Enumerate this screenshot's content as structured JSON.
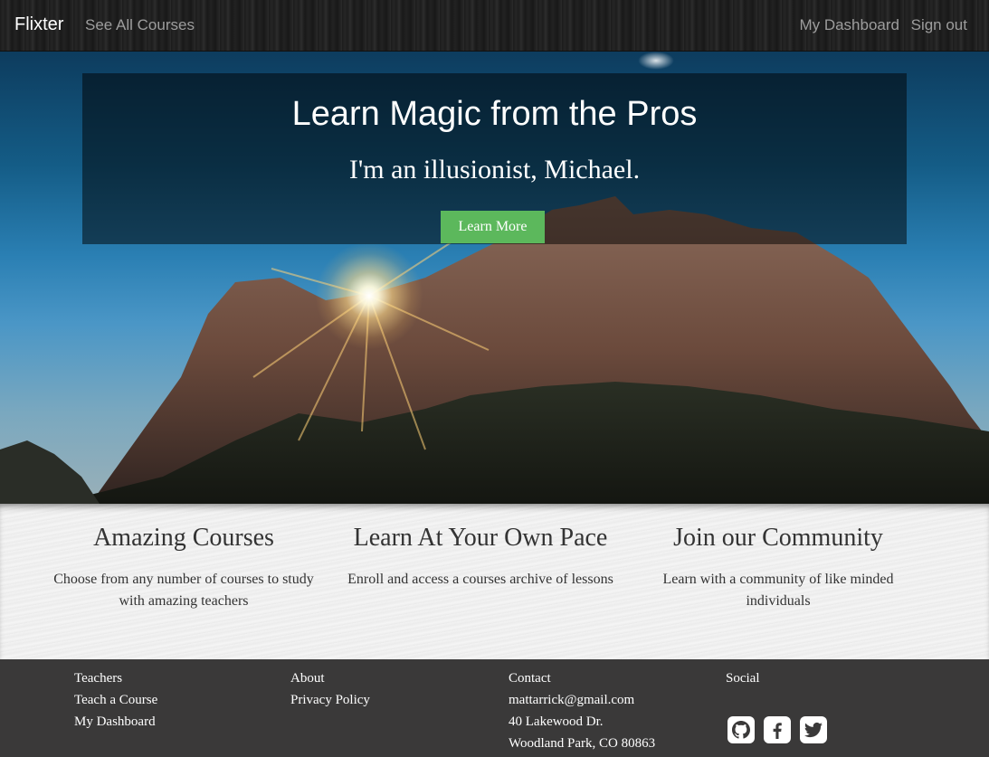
{
  "navbar": {
    "brand": "Flixter",
    "see_all_courses": "See All Courses",
    "my_dashboard": "My Dashboard",
    "sign_out": "Sign out"
  },
  "hero": {
    "title": "Learn Magic from the Pros",
    "subtitle": "I'm an illusionist, Michael.",
    "button_label": "Learn More",
    "button_color": "#5cb85c"
  },
  "features": [
    {
      "title": "Amazing Courses",
      "text": "Choose from any number of courses to study with amazing teachers"
    },
    {
      "title": "Learn At Your Own Pace",
      "text": "Enroll and access a courses archive of lessons"
    },
    {
      "title": "Join our Community",
      "text": "Learn with a community of like minded individuals"
    }
  ],
  "footer": {
    "col1": [
      "Teachers",
      "Teach a Course",
      "My Dashboard"
    ],
    "col2": [
      "About",
      "Privacy Policy"
    ],
    "col3": [
      "Contact",
      "mattarrick@gmail.com",
      "40 Lakewood Dr.",
      "Woodland Park, CO 80863"
    ],
    "social_heading": "Social",
    "social_icons": [
      "github-icon",
      "facebook-icon",
      "twitter-icon"
    ]
  }
}
